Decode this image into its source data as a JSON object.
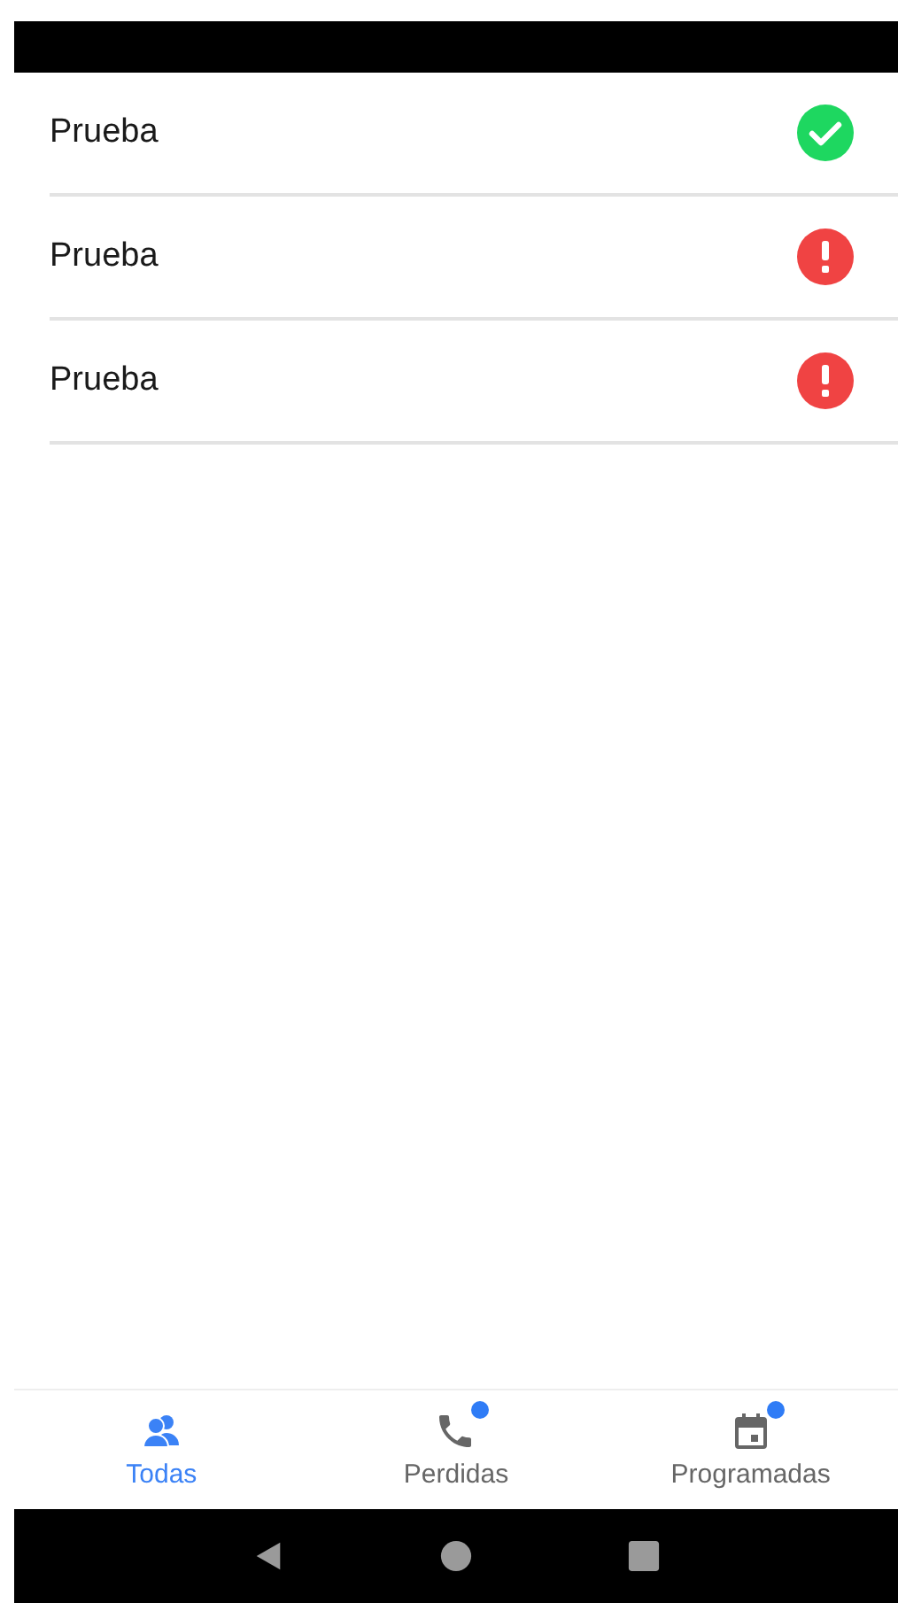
{
  "items": [
    {
      "title": "Prueba",
      "kind": "ok"
    },
    {
      "title": "Prueba",
      "kind": "error"
    },
    {
      "title": "Prueba",
      "kind": "error"
    }
  ],
  "tabs": [
    {
      "label": "Todas",
      "kind": "people",
      "selected": true,
      "badge": false
    },
    {
      "label": "Perdidas",
      "kind": "phone",
      "selected": false,
      "badge": true
    },
    {
      "label": "Programadas",
      "kind": "calendar",
      "selected": false,
      "badge": true
    }
  ]
}
